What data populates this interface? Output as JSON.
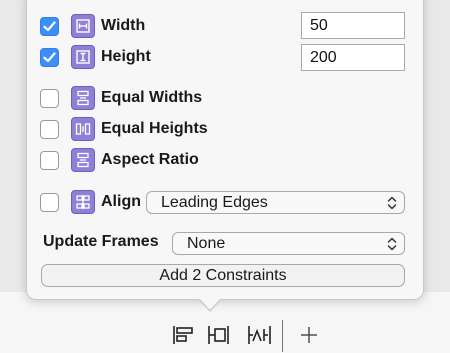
{
  "constraints": {
    "width": {
      "label": "Width",
      "checked": true,
      "value": "50"
    },
    "height": {
      "label": "Height",
      "checked": true,
      "value": "200"
    },
    "equal_widths": {
      "label": "Equal Widths",
      "checked": false
    },
    "equal_heights": {
      "label": "Equal Heights",
      "checked": false
    },
    "aspect_ratio": {
      "label": "Aspect Ratio",
      "checked": false
    }
  },
  "align": {
    "label": "Align",
    "checked": false,
    "selected": "Leading Edges"
  },
  "update_frames": {
    "label": "Update Frames",
    "selected": "None"
  },
  "add_button": {
    "label": "Add 2 Constraints"
  },
  "toolbar": {
    "icons": [
      "align-icon",
      "pin-icon",
      "resolve-issues-icon",
      "add-icon"
    ]
  },
  "colors": {
    "checkbox_checked": "#3b8ff6",
    "constraint_icon": "#8f7fd6"
  }
}
